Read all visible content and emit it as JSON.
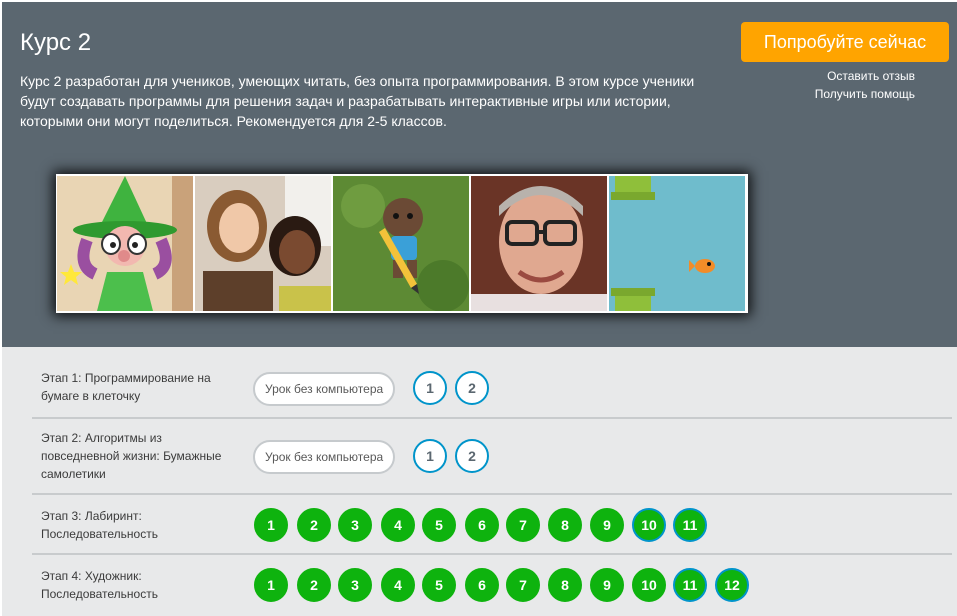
{
  "header": {
    "title": "Курс 2",
    "description": "Курс 2 разработан для учеников, умеющих читать, без опыта программирования. В этом курсе ученики будут создавать программы для решения задач и разрабатывать интерактивные игры или истории, которыми они могут поделиться. Рекомендуется для 2-5 классов.",
    "try_button": "Попробуйте сейчас",
    "feedback_link": "Оставить отзыв",
    "help_link": "Получить помощь"
  },
  "colors": {
    "header_bg": "#5b6770",
    "accent_orange": "#ffa400",
    "completed_green": "#0eb30e",
    "outline_blue": "#0094ca"
  },
  "stages": [
    {
      "label": "Этап 1: Программирование на бумаге в клеточку",
      "unplugged": "Урок без компьютера",
      "levels": [
        {
          "n": "1",
          "state": "outline"
        },
        {
          "n": "2",
          "state": "outline"
        }
      ]
    },
    {
      "label": "Этап 2: Алгоритмы из повседневной жизни: Бумажные самолетики",
      "unplugged": "Урок без компьютера",
      "levels": [
        {
          "n": "1",
          "state": "outline"
        },
        {
          "n": "2",
          "state": "outline"
        }
      ]
    },
    {
      "label": "Этап 3: Лабиринт: Последовательность",
      "levels": [
        {
          "n": "1",
          "state": "green"
        },
        {
          "n": "2",
          "state": "green"
        },
        {
          "n": "3",
          "state": "green"
        },
        {
          "n": "4",
          "state": "green"
        },
        {
          "n": "5",
          "state": "green"
        },
        {
          "n": "6",
          "state": "green"
        },
        {
          "n": "7",
          "state": "green"
        },
        {
          "n": "8",
          "state": "green"
        },
        {
          "n": "9",
          "state": "green"
        },
        {
          "n": "10",
          "state": "green-blue"
        },
        {
          "n": "11",
          "state": "green-blue"
        }
      ]
    },
    {
      "label": "Этап 4: Художник: Последовательность",
      "levels": [
        {
          "n": "1",
          "state": "green"
        },
        {
          "n": "2",
          "state": "green"
        },
        {
          "n": "3",
          "state": "green"
        },
        {
          "n": "4",
          "state": "green"
        },
        {
          "n": "5",
          "state": "green"
        },
        {
          "n": "6",
          "state": "green"
        },
        {
          "n": "7",
          "state": "green"
        },
        {
          "n": "8",
          "state": "green"
        },
        {
          "n": "9",
          "state": "green"
        },
        {
          "n": "10",
          "state": "green"
        },
        {
          "n": "11",
          "state": "green-blue"
        },
        {
          "n": "12",
          "state": "green-blue"
        }
      ]
    }
  ]
}
